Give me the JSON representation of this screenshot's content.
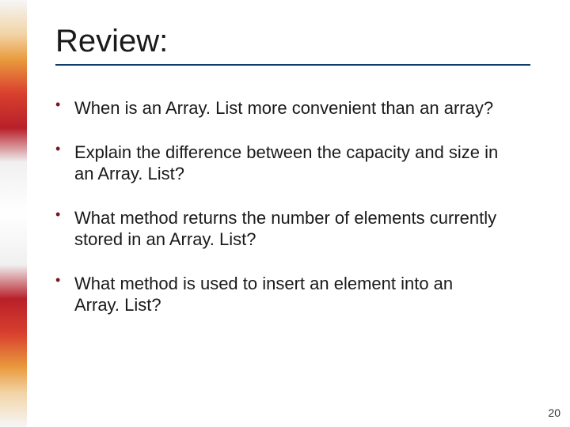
{
  "slide": {
    "heading": "Review:",
    "bullets": [
      "When is an Array. List more convenient than an array?",
      "Explain the difference between the capacity and size in an Array. List?",
      "What method returns the number of elements currently stored in an Array. List?",
      "What method is used to insert an element into an Array. List?"
    ],
    "page_number": "20"
  }
}
